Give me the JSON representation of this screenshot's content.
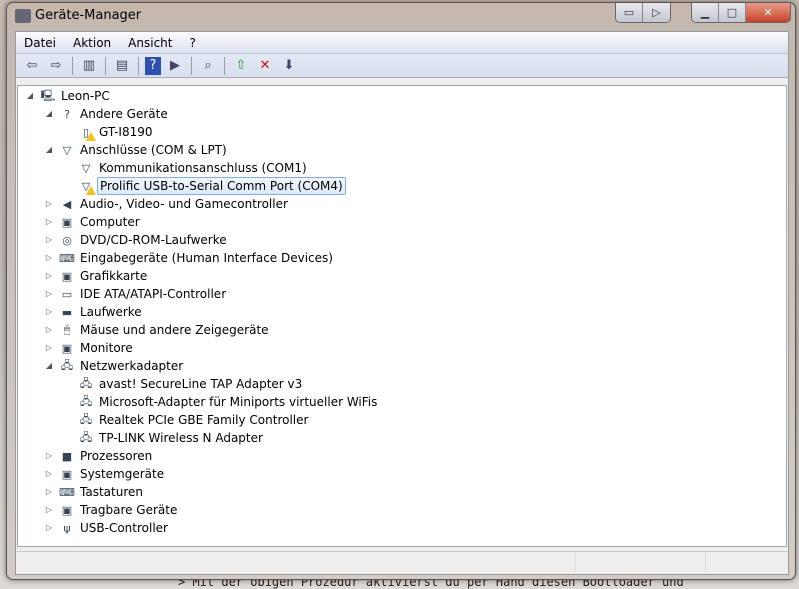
{
  "window": {
    "title": "Geräte-Manager"
  },
  "menu": [
    "Datei",
    "Aktion",
    "Ansicht",
    "?"
  ],
  "toolbar": [
    {
      "name": "back",
      "glyph": "⇦"
    },
    {
      "name": "forward",
      "glyph": "⇨"
    },
    {
      "sep": true
    },
    {
      "name": "show-hide-console-tree",
      "glyph": "▥"
    },
    {
      "sep": true
    },
    {
      "name": "properties",
      "glyph": "▤"
    },
    {
      "sep": true
    },
    {
      "name": "help",
      "glyph": "?"
    },
    {
      "name": "show-hide-action-pane",
      "glyph": "▶"
    },
    {
      "sep": true
    },
    {
      "name": "scan-hardware-changes",
      "glyph": "⌕"
    },
    {
      "sep": true
    },
    {
      "name": "update-driver",
      "glyph": "⇧"
    },
    {
      "name": "uninstall",
      "glyph": "✕"
    },
    {
      "name": "disable",
      "glyph": "⬇"
    }
  ],
  "tree": [
    {
      "level": 0,
      "label": "Leon-PC",
      "exp": "open",
      "icon": "computer"
    },
    {
      "level": 1,
      "label": "Andere Geräte",
      "exp": "open",
      "icon": "unknown-device"
    },
    {
      "level": 2,
      "label": "GT-I8190",
      "icon": "device-warning",
      "warn": true
    },
    {
      "level": 1,
      "label": "Anschlüsse (COM & LPT)",
      "exp": "open",
      "icon": "port"
    },
    {
      "level": 2,
      "label": "Kommunikationsanschluss (COM1)",
      "icon": "port"
    },
    {
      "level": 2,
      "label": "Prolific USB-to-Serial Comm Port (COM4)",
      "icon": "port",
      "warn": true,
      "selected": true
    },
    {
      "level": 1,
      "label": "Audio-, Video- und Gamecontroller",
      "exp": "closed",
      "icon": "speaker"
    },
    {
      "level": 1,
      "label": "Computer",
      "exp": "closed",
      "icon": "monitor"
    },
    {
      "level": 1,
      "label": "DVD/CD-ROM-Laufwerke",
      "exp": "closed",
      "icon": "disc-drive"
    },
    {
      "level": 1,
      "label": "Eingabegeräte (Human Interface Devices)",
      "exp": "closed",
      "icon": "hid"
    },
    {
      "level": 1,
      "label": "Grafikkarte",
      "exp": "closed",
      "icon": "display-adapter"
    },
    {
      "level": 1,
      "label": "IDE ATA/ATAPI-Controller",
      "exp": "closed",
      "icon": "ide"
    },
    {
      "level": 1,
      "label": "Laufwerke",
      "exp": "closed",
      "icon": "drive"
    },
    {
      "level": 1,
      "label": "Mäuse und andere Zeigegeräte",
      "exp": "closed",
      "icon": "mouse"
    },
    {
      "level": 1,
      "label": "Monitore",
      "exp": "closed",
      "icon": "monitor"
    },
    {
      "level": 1,
      "label": "Netzwerkadapter",
      "exp": "open",
      "icon": "network"
    },
    {
      "level": 2,
      "label": "avast! SecureLine TAP Adapter v3",
      "icon": "network"
    },
    {
      "level": 2,
      "label": "Microsoft-Adapter für Miniports virtueller WiFis",
      "icon": "network"
    },
    {
      "level": 2,
      "label": "Realtek PCIe GBE Family Controller",
      "icon": "network"
    },
    {
      "level": 2,
      "label": "TP-LINK Wireless N Adapter",
      "icon": "network"
    },
    {
      "level": 1,
      "label": "Prozessoren",
      "exp": "closed",
      "icon": "processor"
    },
    {
      "level": 1,
      "label": "Systemgeräte",
      "exp": "closed",
      "icon": "system"
    },
    {
      "level": 1,
      "label": "Tastaturen",
      "exp": "closed",
      "icon": "keyboard"
    },
    {
      "level": 1,
      "label": "Tragbare Geräte",
      "exp": "closed",
      "icon": "portable"
    },
    {
      "level": 1,
      "label": "USB-Controller",
      "exp": "closed",
      "icon": "usb"
    }
  ],
  "background_text": "> Mit der obigen Prozedur aktivierst du per Hand diesen Bootloader und"
}
